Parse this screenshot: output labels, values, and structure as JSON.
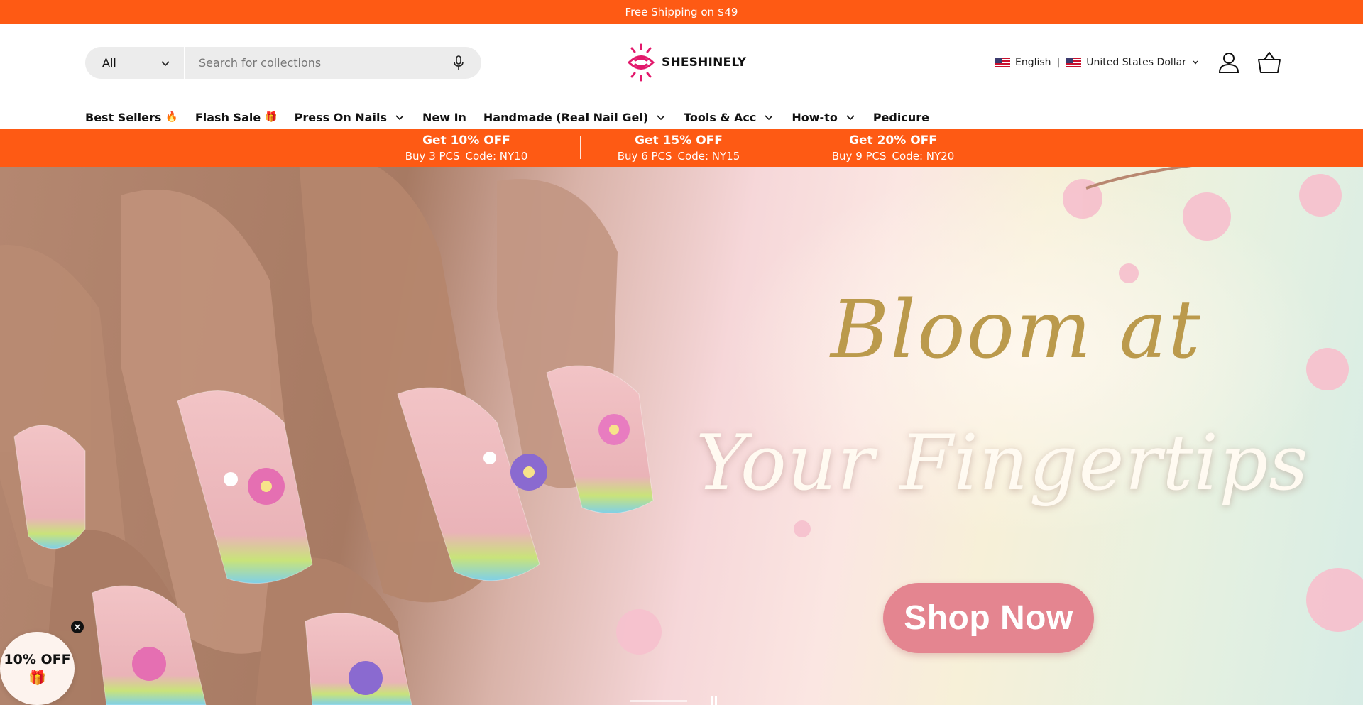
{
  "announcement": {
    "text": "Free Shipping on $49"
  },
  "search": {
    "category": "All",
    "placeholder": "Search for collections"
  },
  "logo": {
    "text": "SHESHINELY"
  },
  "locale": {
    "language": "English",
    "currency": "United States Dollar"
  },
  "nav": {
    "best_sellers": "Best Sellers",
    "best_sellers_emoji": "🔥",
    "flash_sale": "Flash Sale",
    "flash_sale_emoji": "🎁",
    "press_on": "Press On Nails",
    "new_in": "New In",
    "handmade": "Handmade (Real Nail Gel)",
    "tools": "Tools & Acc",
    "howto": "How-to",
    "pedicure": "Pedicure"
  },
  "promos": [
    {
      "title": "Get 10% OFF",
      "qty": "Buy 3 PCS",
      "code": "Code: NY10"
    },
    {
      "title": "Get 15% OFF",
      "qty": "Buy 6 PCS",
      "code": "Code: NY15"
    },
    {
      "title": "Get 20% OFF",
      "qty": "Buy 9 PCS",
      "code": "Code: NY20"
    }
  ],
  "hero": {
    "line1": "Bloom at",
    "line2": "Your Fingertips",
    "cta": "Shop Now"
  },
  "offer_badge": {
    "text": "10% OFF",
    "gift": "🎁"
  },
  "colors": {
    "brand_orange": "#fe5a14",
    "logo_pink": "#e2186b",
    "cta_pink": "#e48590",
    "hero_gold": "#bb9a4c"
  }
}
